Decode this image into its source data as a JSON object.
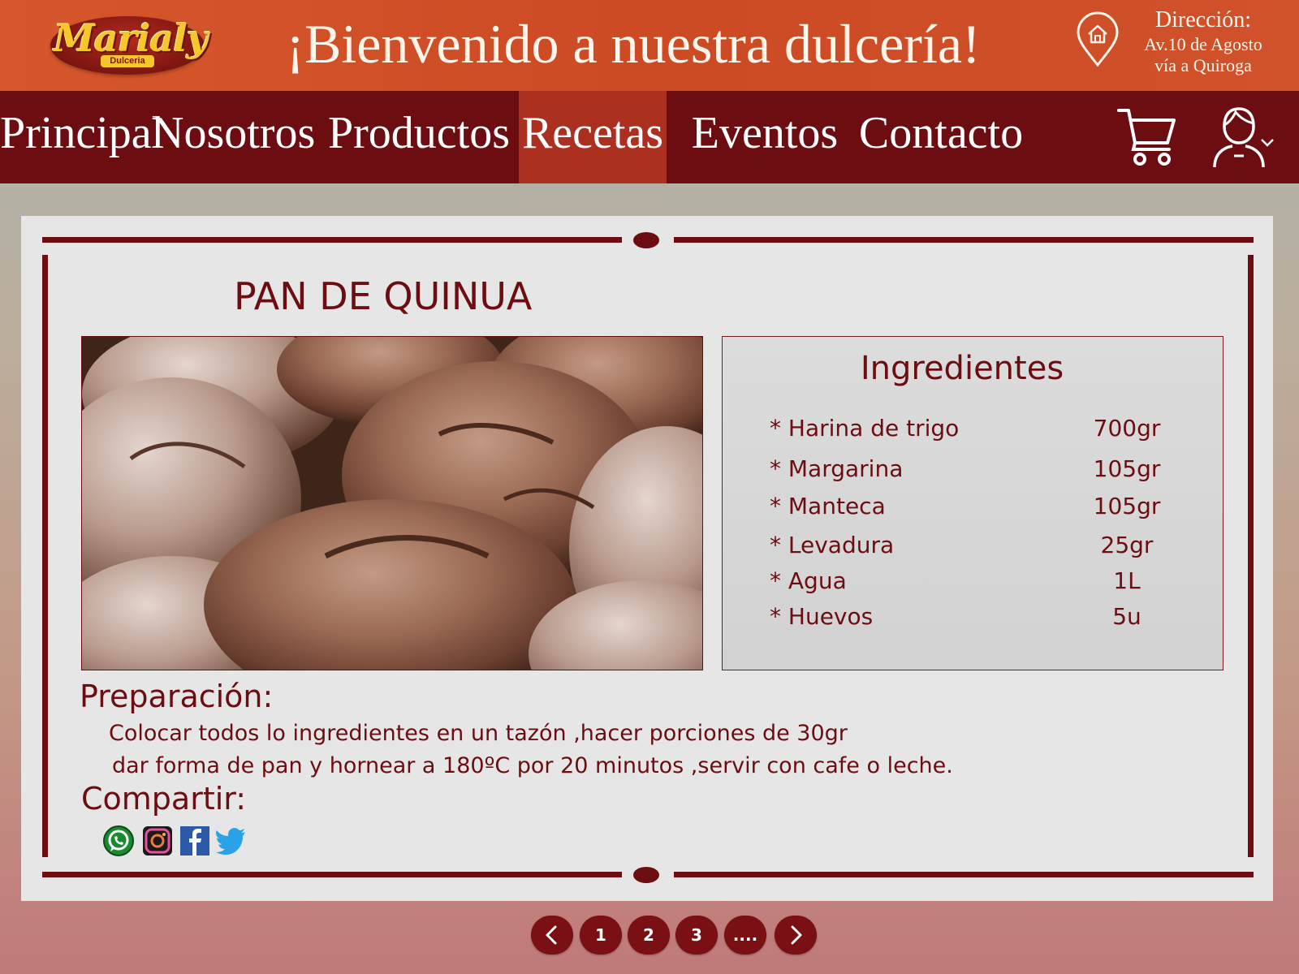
{
  "header": {
    "logo_text": "Marialy",
    "logo_subtext": "Dulceria",
    "welcome": "¡Bienvenido a nuestra dulcería!",
    "address_title": "Dirección:",
    "address_line1": "Av.10 de Agosto",
    "address_line2": "vía a Quiroga",
    "address_icon": "home-location-icon"
  },
  "nav": {
    "items": [
      {
        "label": "Principal",
        "active": false
      },
      {
        "label": "Nosotros",
        "active": false
      },
      {
        "label": "Productos",
        "active": false
      },
      {
        "label": "Recetas",
        "active": true
      },
      {
        "label": "Eventos",
        "active": false
      },
      {
        "label": "Contacto",
        "active": false
      }
    ],
    "cart_icon": "shopping-cart-icon",
    "user_icon": "user-account-icon"
  },
  "recipe": {
    "title": "PAN DE QUINUA",
    "image_subject": "bread-loaves",
    "ingredients_title": "Ingredientes",
    "ingredients": [
      {
        "name": "* Harina de trigo",
        "qty": "700gr"
      },
      {
        "name": "* Margarina",
        "qty": "105gr"
      },
      {
        "name": "* Manteca",
        "qty": "105gr"
      },
      {
        "name": "* Levadura",
        "qty": "25gr"
      },
      {
        "name": "* Agua",
        "qty": "1L"
      },
      {
        "name": "* Huevos",
        "qty": "5u"
      }
    ],
    "preparation_title": "Preparación:",
    "preparation_lines": [
      "Colocar todos lo ingredientes en un tazón ,hacer porciones de 30gr",
      "dar forma de pan y hornear a 180ºC por 20 minutos ,servir con cafe o leche."
    ],
    "share_title": "Compartir:",
    "share_icons": [
      "whatsapp-icon",
      "instagram-icon",
      "facebook-icon",
      "twitter-icon"
    ]
  },
  "pagination": {
    "prev_icon": "chevron-left-icon",
    "pages": [
      "1",
      "2",
      "3",
      "...."
    ],
    "next_icon": "chevron-right-icon"
  },
  "colors": {
    "header_orange": "#d6572c",
    "nav_maroon": "#6b0d11",
    "nav_active": "#ab3020",
    "text_maroon": "#6b0d11",
    "card_bg": "#e6e6e6"
  }
}
